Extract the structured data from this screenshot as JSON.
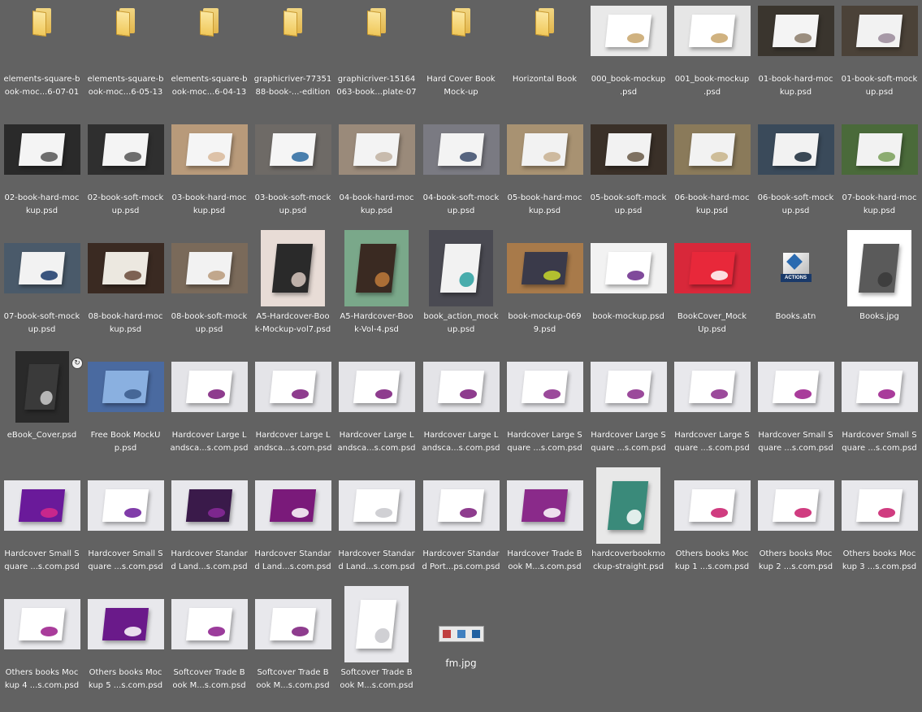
{
  "items": [
    {
      "label": "elements-square-b\nook-moc...6-07-01",
      "kind": "folder"
    },
    {
      "label": "elements-square-b\nook-moc...6-05-13",
      "kind": "folder"
    },
    {
      "label": "elements-square-b\nook-moc...6-04-13",
      "kind": "folder"
    },
    {
      "label": "graphicriver-77351\n88-book-...-edition",
      "kind": "folder"
    },
    {
      "label": "graphicriver-15164\n063-book...plate-07",
      "kind": "folder"
    },
    {
      "label": "Hard Cover Book\nMock-up",
      "kind": "folder"
    },
    {
      "label": "Horizontal Book",
      "kind": "folder"
    },
    {
      "label": "000_book-mockup\n.psd",
      "kind": "img",
      "bg": "#e9e9e9",
      "book": "#ffffff",
      "accent": "#c8a56a"
    },
    {
      "label": "001_book-mockup\n.psd",
      "kind": "img",
      "bg": "#e6e6e6",
      "book": "#ffffff",
      "accent": "#c8a56a"
    },
    {
      "label": "01-book-hard-moc\nkup.psd",
      "kind": "img",
      "bg": "#3a352e",
      "book": "#f4f4f4",
      "accent": "#8a7a68"
    },
    {
      "label": "01-book-soft-mock\nup.psd",
      "kind": "img",
      "bg": "#4b4238",
      "book": "#f2f2f2",
      "accent": "#9a8a9a"
    },
    {
      "label": "02-book-hard-moc\nkup.psd",
      "kind": "img",
      "bg": "#2a2a2a",
      "book": "#f4f4f4",
      "accent": "#555555"
    },
    {
      "label": "02-book-soft-mock\nup.psd",
      "kind": "img",
      "bg": "#2f2f2f",
      "book": "#f4f4f4",
      "accent": "#555555"
    },
    {
      "label": "03-book-hard-moc\nkup.psd",
      "kind": "img",
      "bg": "#b89a7a",
      "book": "#f5f5f5",
      "accent": "#d8b89a"
    },
    {
      "label": "03-book-soft-mock\nup.psd",
      "kind": "img",
      "bg": "#6e6a66",
      "book": "#f5f5f5",
      "accent": "#2a6aa0"
    },
    {
      "label": "04-book-hard-moc\nkup.psd",
      "kind": "img",
      "bg": "#9a8a7a",
      "book": "#f3f3f3",
      "accent": "#c0b0a0"
    },
    {
      "label": "04-book-soft-mock\nup.psd",
      "kind": "img",
      "bg": "#7a7a82",
      "book": "#f3f3f3",
      "accent": "#3a4a6a"
    },
    {
      "label": "05-book-hard-moc\nkup.psd",
      "kind": "img",
      "bg": "#a89272",
      "book": "#f2f2f2",
      "accent": "#c8b090"
    },
    {
      "label": "05-book-soft-mock\nup.psd",
      "kind": "img",
      "bg": "#3a3028",
      "book": "#f2f2f2",
      "accent": "#6a5a48"
    },
    {
      "label": "06-book-hard-moc\nkup.psd",
      "kind": "img",
      "bg": "#8a7a5a",
      "book": "#f2f2f2",
      "accent": "#c8b48a"
    },
    {
      "label": "06-book-soft-mock\nup.psd",
      "kind": "img",
      "bg": "#3a4a5a",
      "book": "#f2f2f2",
      "accent": "#1a2a3a"
    },
    {
      "label": "07-book-hard-moc\nkup.psd",
      "kind": "img",
      "bg": "#4a6a3a",
      "book": "#f2f2f2",
      "accent": "#7aa05a"
    },
    {
      "label": "07-book-soft-mock\nup.psd",
      "kind": "img",
      "bg": "#4a5a6a",
      "book": "#f2f2f2",
      "accent": "#1a3a6a"
    },
    {
      "label": "08-book-hard-moc\nkup.psd",
      "kind": "img",
      "bg": "#3a2a22",
      "book": "#ece8e0",
      "accent": "#6a4a3a"
    },
    {
      "label": "08-book-soft-mock\nup.psd",
      "kind": "img",
      "bg": "#7a6a5a",
      "book": "#f2f2f2",
      "accent": "#b89a7a"
    },
    {
      "label": "A5-Hardcover-Boo\nk-Mockup-vol7.psd",
      "kind": "img",
      "bg": "#e8dcd6",
      "book": "#2a2a2a",
      "accent": "#d8c8c0",
      "tall": true
    },
    {
      "label": "A5-Hardcover-Boo\nk-Vol-4.psd",
      "kind": "img",
      "bg": "#7aa88a",
      "book": "#3a2a22",
      "accent": "#c07a3a",
      "tall": true
    },
    {
      "label": "book_action_mock\nup.psd",
      "kind": "img",
      "bg": "#4a4a52",
      "book": "#f2f2f2",
      "accent": "#2aa0a0",
      "tall": true
    },
    {
      "label": "book-mockup-069\n9.psd",
      "kind": "img",
      "bg": "#a87a4a",
      "book": "#3a3a4a",
      "accent": "#c8d82a"
    },
    {
      "label": "book-mockup.psd",
      "kind": "img",
      "bg": "#f2f2f2",
      "book": "#ffffff",
      "accent": "#6a2a8a"
    },
    {
      "label": "BookCover_Mock\nUp.psd",
      "kind": "img",
      "bg": "#d8283a",
      "book": "#e8283a",
      "accent": "#ffffff"
    },
    {
      "label": "Books.atn",
      "kind": "atn"
    },
    {
      "label": "Books.jpg",
      "kind": "img",
      "bg": "#ffffff",
      "book": "#5a5a5a",
      "accent": "#3a3a3a",
      "tall": true
    },
    {
      "label": "eBook_Cover.psd",
      "kind": "img",
      "bg": "#2a2a2a",
      "book": "#3a3a3a",
      "accent": "#cccccc",
      "tall2": true,
      "sync": true
    },
    {
      "label": "Free Book MockU\np.psd",
      "kind": "img",
      "bg": "#4a6aa0",
      "book": "#8ab0e0",
      "accent": "#3a5a8a"
    },
    {
      "label": "Hardcover Large L\nandsca...s.com.psd",
      "kind": "img",
      "bg": "#e4e4e8",
      "book": "#ffffff",
      "accent": "#7a1a7a"
    },
    {
      "label": "Hardcover Large L\nandsca...s.com.psd",
      "kind": "img",
      "bg": "#e4e4e8",
      "book": "#ffffff",
      "accent": "#7a1a7a"
    },
    {
      "label": "Hardcover Large L\nandsca...s.com.psd",
      "kind": "img",
      "bg": "#e4e4e8",
      "book": "#ffffff",
      "accent": "#7a1a7a"
    },
    {
      "label": "Hardcover Large L\nandsca...s.com.psd",
      "kind": "img",
      "bg": "#e4e4e8",
      "book": "#ffffff",
      "accent": "#7a1a7a"
    },
    {
      "label": "Hardcover Large S\nquare ...s.com.psd",
      "kind": "img",
      "bg": "#e8e8ec",
      "book": "#ffffff",
      "accent": "#8a2a8a"
    },
    {
      "label": "Hardcover Large S\nquare ...s.com.psd",
      "kind": "img",
      "bg": "#e8e8ec",
      "book": "#ffffff",
      "accent": "#8a2a8a"
    },
    {
      "label": "Hardcover Large S\nquare ...s.com.psd",
      "kind": "img",
      "bg": "#e8e8ec",
      "book": "#ffffff",
      "accent": "#8a2a8a"
    },
    {
      "label": "Hardcover Small S\nquare ...s.com.psd",
      "kind": "img",
      "bg": "#e8e8ec",
      "book": "#ffffff",
      "accent": "#9a1a8a"
    },
    {
      "label": "Hardcover Small S\nquare ...s.com.psd",
      "kind": "img",
      "bg": "#e8e8ec",
      "book": "#ffffff",
      "accent": "#9a1a8a"
    },
    {
      "label": "Hardcover Small S\nquare ...s.com.psd",
      "kind": "img",
      "bg": "#e8e8ec",
      "book": "#6a1a9a",
      "accent": "#d82a8a"
    },
    {
      "label": "Hardcover Small S\nquare ...s.com.psd",
      "kind": "img",
      "bg": "#e8e8ec",
      "book": "#ffffff",
      "accent": "#6a1a9a"
    },
    {
      "label": "Hardcover Standar\nd Land...s.com.psd",
      "kind": "img",
      "bg": "#e8e8ec",
      "book": "#3a1a4a",
      "accent": "#8a2a9a"
    },
    {
      "label": "Hardcover Standar\nd Land...s.com.psd",
      "kind": "img",
      "bg": "#e8e8ec",
      "book": "#7a1a7a",
      "accent": "#ffffff"
    },
    {
      "label": "Hardcover Standar\nd Land...s.com.psd",
      "kind": "img",
      "bg": "#e8e8ec",
      "book": "#ffffff",
      "accent": "#c8c8cc"
    },
    {
      "label": "Hardcover Standar\nd Port...ps.com.psd",
      "kind": "img",
      "bg": "#e8e8ec",
      "book": "#ffffff",
      "accent": "#7a1a7a"
    },
    {
      "label": "Hardcover Trade B\nook M...s.com.psd",
      "kind": "img",
      "bg": "#e8e8ec",
      "book": "#8a2a8a",
      "accent": "#ffffff"
    },
    {
      "label": "hardcoverbookmo\nckup-straight.psd",
      "kind": "img",
      "bg": "#e8e8e8",
      "book": "#3a8a7a",
      "accent": "#ffffff",
      "tall": true
    },
    {
      "label": "Others books Moc\nkup 1 ...s.com.psd",
      "kind": "img",
      "bg": "#e8e8ec",
      "book": "#ffffff",
      "accent": "#c81a6a"
    },
    {
      "label": "Others books Moc\nkup 2 ...s.com.psd",
      "kind": "img",
      "bg": "#e8e8ec",
      "book": "#ffffff",
      "accent": "#c81a6a"
    },
    {
      "label": "Others books Moc\nkup 3 ...s.com.psd",
      "kind": "img",
      "bg": "#e8e8ec",
      "book": "#ffffff",
      "accent": "#c81a6a"
    },
    {
      "label": "Others books Moc\nkup 4 ...s.com.psd",
      "kind": "img",
      "bg": "#e8e8ec",
      "book": "#ffffff",
      "accent": "#9a1a8a"
    },
    {
      "label": "Others books Moc\nkup 5 ...s.com.psd",
      "kind": "img",
      "bg": "#e8e8ec",
      "book": "#6a1a8a",
      "accent": "#ffffff"
    },
    {
      "label": "Softcover Trade B\nook M...s.com.psd",
      "kind": "img",
      "bg": "#e8e8ec",
      "book": "#ffffff",
      "accent": "#8a1a8a"
    },
    {
      "label": "Softcover Trade B\nook M...s.com.psd",
      "kind": "img",
      "bg": "#e8e8ec",
      "book": "#ffffff",
      "accent": "#7a1a7a"
    },
    {
      "label": "Softcover Trade B\nook M...s.com.psd",
      "kind": "img",
      "bg": "#e8e8ec",
      "book": "#ffffff",
      "accent": "#c8c8cc",
      "tall": true
    },
    {
      "label": "fm.jpg",
      "kind": "fm"
    }
  ]
}
